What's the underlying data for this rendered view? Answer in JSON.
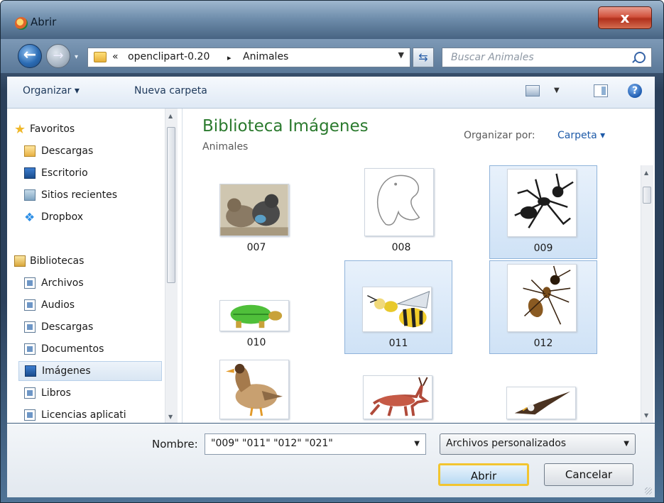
{
  "window": {
    "title": "Abrir",
    "close": "x"
  },
  "nav": {
    "breadcrumb": [
      "«",
      "openclipart-0.20",
      "▸",
      "Animales"
    ],
    "search_placeholder": "Buscar Animales"
  },
  "toolbar": {
    "organize": "Organizar ▾",
    "new_folder": "Nueva carpeta",
    "help": "?"
  },
  "sidebar": {
    "favorites": {
      "label": "Favoritos",
      "items": [
        "Descargas",
        "Escritorio",
        "Sitios recientes",
        "Dropbox"
      ]
    },
    "libraries": {
      "label": "Bibliotecas",
      "items": [
        "Archivos",
        "Audios",
        "Descargas",
        "Documentos",
        "Imágenes",
        "Libros",
        "Licencias aplicati"
      ]
    },
    "selected": "Imágenes"
  },
  "content": {
    "title": "Biblioteca Imágenes",
    "subtitle": "Animales",
    "arrange_label": "Organizar por:",
    "arrange_value": "Carpeta ▾",
    "files": [
      {
        "name": "007",
        "selected": false,
        "icon": "kittens-thumbnail"
      },
      {
        "name": "008",
        "selected": false,
        "icon": "whale-outline-thumbnail"
      },
      {
        "name": "009",
        "selected": true,
        "icon": "ant-thumbnail"
      },
      {
        "name": "010",
        "selected": false,
        "icon": "turtle-thumbnail"
      },
      {
        "name": "011",
        "selected": true,
        "icon": "bee-thumbnail"
      },
      {
        "name": "012",
        "selected": true,
        "icon": "ant-2-thumbnail"
      },
      {
        "name": "",
        "selected": false,
        "icon": "duck-thumbnail"
      },
      {
        "name": "",
        "selected": false,
        "icon": "antelope-thumbnail"
      },
      {
        "name": "",
        "selected": false,
        "icon": "eagle-thumbnail"
      }
    ]
  },
  "bottom": {
    "name_label": "Nombre:",
    "name_value": "\"009\" \"011\" \"012\" \"021\"",
    "filter_value": "Archivos personalizados",
    "open_button": "Abrir",
    "cancel_button": "Cancelar"
  },
  "colors": {
    "accent": "#2b7a2e",
    "link": "#1e5aa8",
    "focus_outline": "#f2c530",
    "selection": "#cfe2f6"
  }
}
